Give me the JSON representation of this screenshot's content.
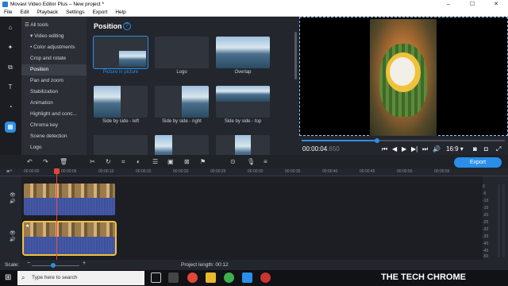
{
  "window": {
    "title": "Movavi Video Editor Plus – New project *",
    "min": "–",
    "max": "☐",
    "close": "✕"
  },
  "menu": [
    "File",
    "Edit",
    "Playback",
    "Settings",
    "Export",
    "Help"
  ],
  "rail_icons": [
    "import-icon",
    "filters-icon",
    "transitions-icon",
    "titles-icon",
    "stickers-icon",
    "more-tools-icon"
  ],
  "tools": {
    "all_tools": "All tools",
    "items": [
      "Video editing",
      "Color adjustments",
      "Crop and rotate",
      "Position",
      "Pan and zoom",
      "Stabilization",
      "Animation",
      "Highlight and conc...",
      "Chroma key",
      "Scene detection",
      "Logo"
    ],
    "selected": "Position"
  },
  "panel": {
    "title": "Position",
    "help": "?",
    "tiles": [
      {
        "label": "Picture in picture",
        "selected": true
      },
      {
        "label": "Logo",
        "selected": false
      },
      {
        "label": "Overlap",
        "selected": false
      },
      {
        "label": "Side by side - left",
        "selected": false
      },
      {
        "label": "Side by side - right",
        "selected": false
      },
      {
        "label": "Side by side - top",
        "selected": false
      }
    ]
  },
  "player": {
    "timecode": "00:00:04",
    "timecode_frac": ".650",
    "progress": 0.37,
    "aspect": "16:9 ▾",
    "buttons": [
      "⏮",
      "◀",
      "▶",
      "▶|",
      "⏭",
      "🔊"
    ]
  },
  "toolbar": {
    "export": "Export"
  },
  "ruler": [
    "00:00:00",
    "00:00:05",
    "00:00:10",
    "00:00:15",
    "00:00:20",
    "00:00:25",
    "00:00:30",
    "00:00:35",
    "00:00:40",
    "00:00:45",
    "00:00:50",
    "00:00:55"
  ],
  "meter": [
    "0",
    "-5",
    "-10",
    "-15",
    "-20",
    "-25",
    "-30",
    "-35",
    "-40",
    "-45",
    "-50"
  ],
  "status": {
    "scale_label": "Scale:",
    "project_length": "Project length:  00:12"
  },
  "taskbar": {
    "search_placeholder": "Type here to search",
    "brand": "THE TECH CHROME"
  },
  "colors": {
    "accent": "#2a8fe8",
    "selected_clip": "#f0c23c",
    "playhead": "#e2463a"
  }
}
